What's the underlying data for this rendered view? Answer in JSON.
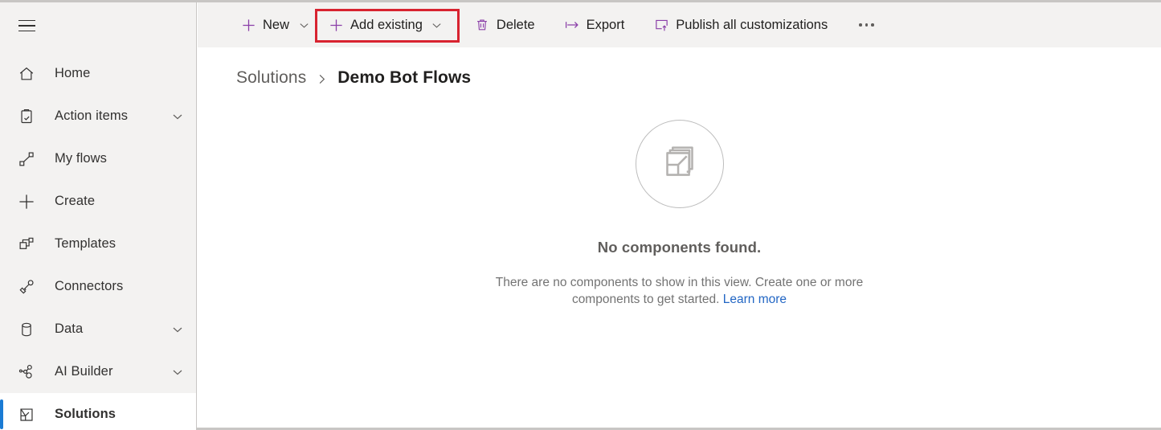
{
  "colors": {
    "accent_purple": "#8a3ea8",
    "highlight_red": "#d82330",
    "selected_blue": "#1a7bd4",
    "link_blue": "#2266c4",
    "chrome_gray": "#f3f2f1"
  },
  "sidebar": {
    "menu_button": "menu-icon",
    "items": [
      {
        "label": "Home",
        "icon": "home-icon",
        "chevron": false,
        "selected": false
      },
      {
        "label": "Action items",
        "icon": "clipboard-check-icon",
        "chevron": true,
        "selected": false
      },
      {
        "label": "My flows",
        "icon": "flow-icon",
        "chevron": false,
        "selected": false
      },
      {
        "label": "Create",
        "icon": "plus-icon",
        "chevron": false,
        "selected": false
      },
      {
        "label": "Templates",
        "icon": "templates-icon",
        "chevron": false,
        "selected": false
      },
      {
        "label": "Connectors",
        "icon": "connectors-icon",
        "chevron": false,
        "selected": false
      },
      {
        "label": "Data",
        "icon": "database-icon",
        "chevron": true,
        "selected": false
      },
      {
        "label": "AI Builder",
        "icon": "ai-builder-icon",
        "chevron": true,
        "selected": false
      },
      {
        "label": "Solutions",
        "icon": "solutions-icon",
        "chevron": false,
        "selected": true
      }
    ]
  },
  "toolbar": {
    "new_label": "New",
    "add_existing_label": "Add existing",
    "delete_label": "Delete",
    "export_label": "Export",
    "publish_label": "Publish all customizations",
    "overflow_label": "More commands",
    "highlighted_command": "Add existing"
  },
  "breadcrumb": {
    "root": "Solutions",
    "separator": "›",
    "current": "Demo Bot Flows"
  },
  "empty_state": {
    "icon": "solution-empty-icon",
    "title": "No components found.",
    "description": "There are no components to show in this view. Create one or more components to get started.",
    "link": "Learn more"
  }
}
